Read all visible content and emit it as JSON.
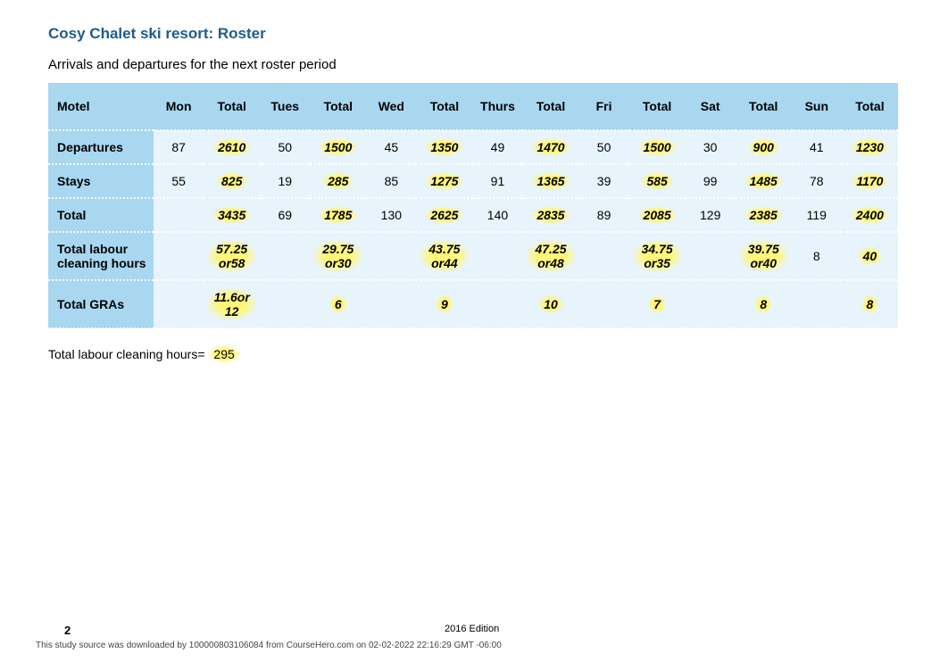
{
  "title": "Cosy Chalet ski resort: Roster",
  "subtitle": "Arrivals and departures for the next roster period",
  "headers": [
    "Motel",
    "Mon",
    "Total",
    "Tues",
    "Total",
    "Wed",
    "Total",
    "Thurs",
    "Total",
    "Fri",
    "Total",
    "Sat",
    "Total",
    "Sun",
    "Total"
  ],
  "rows": [
    {
      "label": "Departures",
      "cells": [
        "87",
        {
          "hl": "2610"
        },
        "50",
        {
          "hl": "1500"
        },
        "45",
        {
          "hl": "1350"
        },
        "49",
        {
          "hl": "1470"
        },
        "50",
        {
          "hl": "1500"
        },
        "30",
        {
          "hl": "900"
        },
        "41",
        {
          "hl": "1230"
        }
      ]
    },
    {
      "label": "Stays",
      "cells": [
        "55",
        {
          "hl": "825"
        },
        "19",
        {
          "hl": "285"
        },
        "85",
        {
          "hl": "1275"
        },
        "91",
        {
          "hl": "1365"
        },
        "39",
        {
          "hl": "585"
        },
        "99",
        {
          "hl": "1485"
        },
        "78",
        {
          "hl": "1170"
        }
      ]
    },
    {
      "label": "Total",
      "cells": [
        "",
        {
          "hl": "3435"
        },
        "69",
        {
          "hl": "1785"
        },
        "130",
        {
          "hl": "2625"
        },
        "140",
        {
          "hl": "2835"
        },
        "89",
        {
          "hl": "2085"
        },
        "129",
        {
          "hl": "2385"
        },
        "119",
        {
          "hl": "2400"
        }
      ]
    },
    {
      "label": "Total labour cleaning hours",
      "cells": [
        "",
        {
          "hl": "57.25 or58"
        },
        "",
        {
          "hl": "29.75 or30"
        },
        "",
        {
          "hl": "43.75 or44"
        },
        "",
        {
          "hl": "47.25 or48"
        },
        "",
        {
          "hl": "34.75 or35"
        },
        "",
        {
          "hl": "39.75 or40"
        },
        "8",
        {
          "hl": "40"
        }
      ]
    },
    {
      "label": "Total GRAs",
      "cells": [
        "",
        {
          "hl": "11.6or 12"
        },
        "",
        {
          "hl": "6"
        },
        "",
        {
          "hl": "9"
        },
        "",
        {
          "hl": "10"
        },
        "",
        {
          "hl": "7"
        },
        "",
        {
          "hl": "8"
        },
        "",
        {
          "hl": "8"
        }
      ]
    }
  ],
  "footnote_prefix": "Total labour cleaning hours= ",
  "footnote_value": "295",
  "footer": {
    "page": "2",
    "edition": "2016 Edition",
    "download": "This study source was downloaded by 100000803106084 from CourseHero.com on 02-02-2022 22:16:29 GMT -06:00"
  },
  "chart_data": {
    "type": "table",
    "title": "Cosy Chalet ski resort: Roster — Arrivals and departures for the next roster period",
    "columns": [
      "Motel",
      "Mon",
      "Total",
      "Tues",
      "Total",
      "Wed",
      "Total",
      "Thurs",
      "Total",
      "Fri",
      "Total",
      "Sat",
      "Total",
      "Sun",
      "Total"
    ],
    "rows": [
      [
        "Departures",
        87,
        2610,
        50,
        1500,
        45,
        1350,
        49,
        1470,
        50,
        1500,
        30,
        900,
        41,
        1230
      ],
      [
        "Stays",
        55,
        825,
        19,
        285,
        85,
        1275,
        91,
        1365,
        39,
        585,
        99,
        1485,
        78,
        1170
      ],
      [
        "Total",
        null,
        3435,
        69,
        1785,
        130,
        2625,
        140,
        2835,
        89,
        2085,
        129,
        2385,
        119,
        2400
      ],
      [
        "Total labour cleaning hours",
        null,
        "57.25 or 58",
        null,
        "29.75 or 30",
        null,
        "43.75 or 44",
        null,
        "47.25 or 48",
        null,
        "34.75 or 35",
        null,
        "39.75 or 40",
        8,
        40
      ],
      [
        "Total GRAs",
        null,
        "11.6 or 12",
        null,
        6,
        null,
        9,
        null,
        10,
        null,
        7,
        null,
        8,
        null,
        8
      ]
    ],
    "total_labour_cleaning_hours": 295
  }
}
